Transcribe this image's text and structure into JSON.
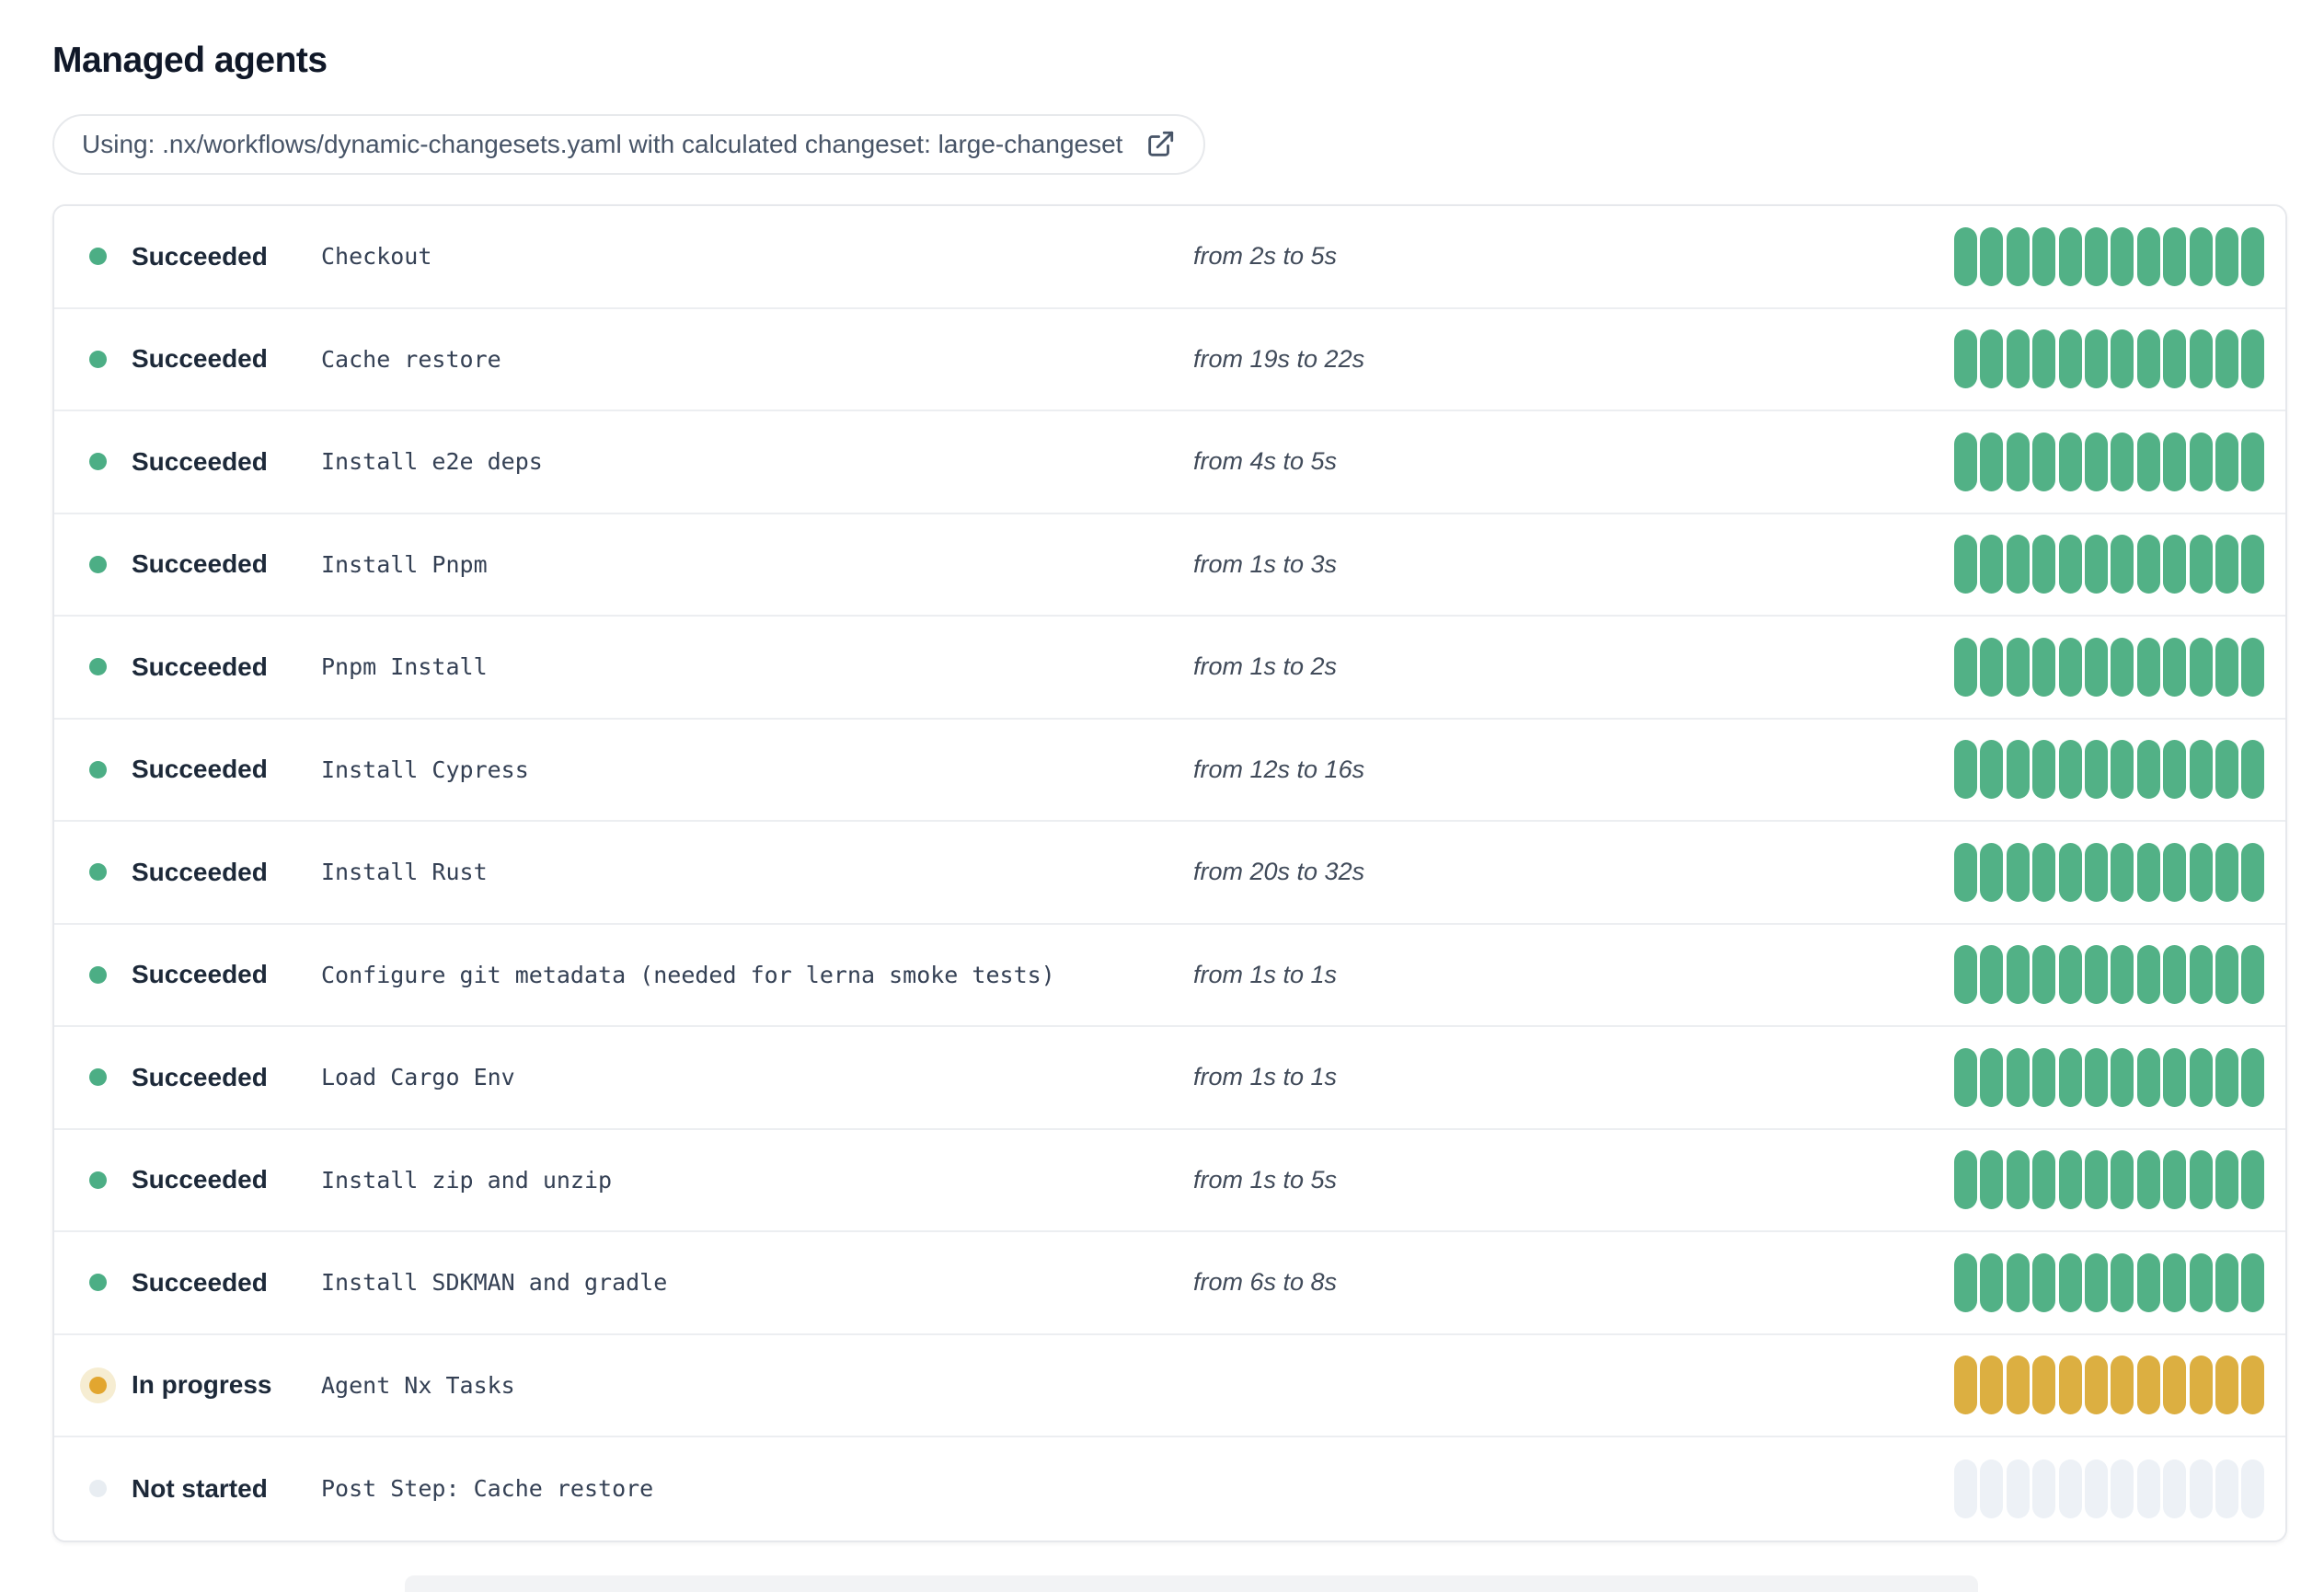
{
  "header": {
    "title": "Managed agents"
  },
  "banner": {
    "label": "Using: .nx/workflows/dynamic-changesets.yaml with calculated changeset: large-changeset",
    "icon": "external-link-icon"
  },
  "statuses": {
    "succeeded": {
      "label": "Succeeded",
      "dot_color": "#4cae85",
      "bar_color": "#52b186"
    },
    "in_progress": {
      "label": "In progress",
      "dot_color": "#e2a62f",
      "dot_halo_color": "#f6edd2",
      "bar_color": "#dcaf41"
    },
    "not_started": {
      "label": "Not started",
      "dot_color": "#e8edf2",
      "bar_color": "#edf1f6"
    }
  },
  "agents": {
    "segments_per_bar": 12,
    "rows": [
      {
        "status": "succeeded",
        "step": "Checkout",
        "duration": "from 2s to 5s"
      },
      {
        "status": "succeeded",
        "step": "Cache restore",
        "duration": "from 19s to 22s"
      },
      {
        "status": "succeeded",
        "step": "Install e2e deps",
        "duration": "from 4s to 5s"
      },
      {
        "status": "succeeded",
        "step": "Install Pnpm",
        "duration": "from 1s to 3s"
      },
      {
        "status": "succeeded",
        "step": "Pnpm Install",
        "duration": "from 1s to 2s"
      },
      {
        "status": "succeeded",
        "step": "Install Cypress",
        "duration": "from 12s to 16s"
      },
      {
        "status": "succeeded",
        "step": "Install Rust",
        "duration": "from 20s to 32s"
      },
      {
        "status": "succeeded",
        "step": "Configure git metadata (needed for lerna smoke tests)",
        "duration": "from 1s to 1s"
      },
      {
        "status": "succeeded",
        "step": "Load Cargo Env",
        "duration": "from 1s to 1s"
      },
      {
        "status": "succeeded",
        "step": "Install zip and unzip",
        "duration": "from 1s to 5s"
      },
      {
        "status": "succeeded",
        "step": "Install SDKMAN and gradle",
        "duration": "from 6s to 8s"
      },
      {
        "status": "in_progress",
        "step": "Agent Nx Tasks",
        "duration": ""
      },
      {
        "status": "not_started",
        "step": "Post Step: Cache restore",
        "duration": ""
      }
    ]
  }
}
